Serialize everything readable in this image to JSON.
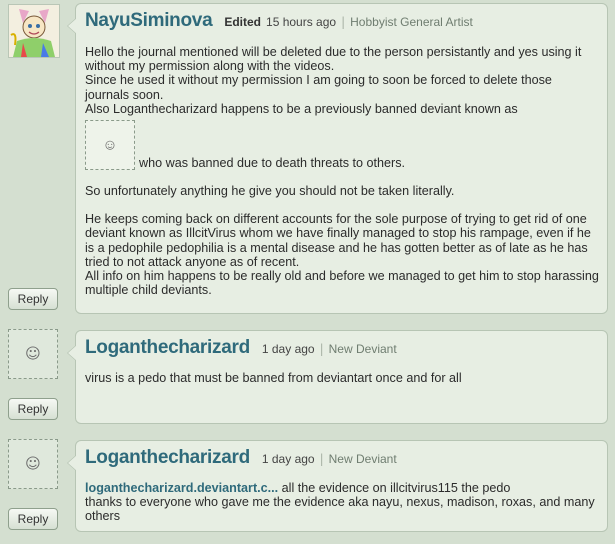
{
  "comments": [
    {
      "username": "NayuSiminova",
      "edited": "Edited",
      "timestamp": "15 hours ago",
      "user_type": "Hobbyist General Artist",
      "reply_label": "Reply",
      "body": {
        "p1": "Hello the journal mentioned will be deleted due to the person persistantly and yes using it without my permission along with the videos.",
        "p2": "Since he used it without my permission I am going to soon be forced to delete those journals soon.",
        "p3": "Also Loganthecharizard happens to be a previously banned deviant known as",
        "p4": "who was banned due to death threats to others.",
        "p5": "So unfortunately anything he give you should not be taken literally.",
        "p6": "He keeps coming back on different accounts for the sole purpose of trying to get rid of one deviant known as IllcitVirus whom we have finally managed to stop his rampage, even if he is a pedophile pedophilia is a mental disease and he has gotten better as of late as he has tried to not attack anyone as of recent.",
        "p7": "All info on him happens to be really old and before we managed to get him to stop harassing multiple child deviants."
      }
    },
    {
      "username": "Loganthecharizard",
      "timestamp": "1 day ago",
      "user_type": "New Deviant",
      "reply_label": "Reply",
      "body": {
        "p1": "virus is a pedo that must be banned from deviantart once and for all"
      }
    },
    {
      "username": "Loganthecharizard",
      "timestamp": "1 day ago",
      "user_type": "New Deviant",
      "reply_label": "Reply",
      "body": {
        "link": "loganthecharizard.deviantart.c...",
        "p1": " all the evidence on illcitvirus115 the pedo",
        "p2": "thanks to everyone who gave me the evidence aka nayu, nexus, madison, roxas, and many others"
      }
    }
  ],
  "icons": {
    "emote_face": "☺",
    "separator": "|"
  },
  "colors": {
    "username": "#2f6a7b",
    "background": "#d4dfd0",
    "bubble": "#e7eee3"
  }
}
